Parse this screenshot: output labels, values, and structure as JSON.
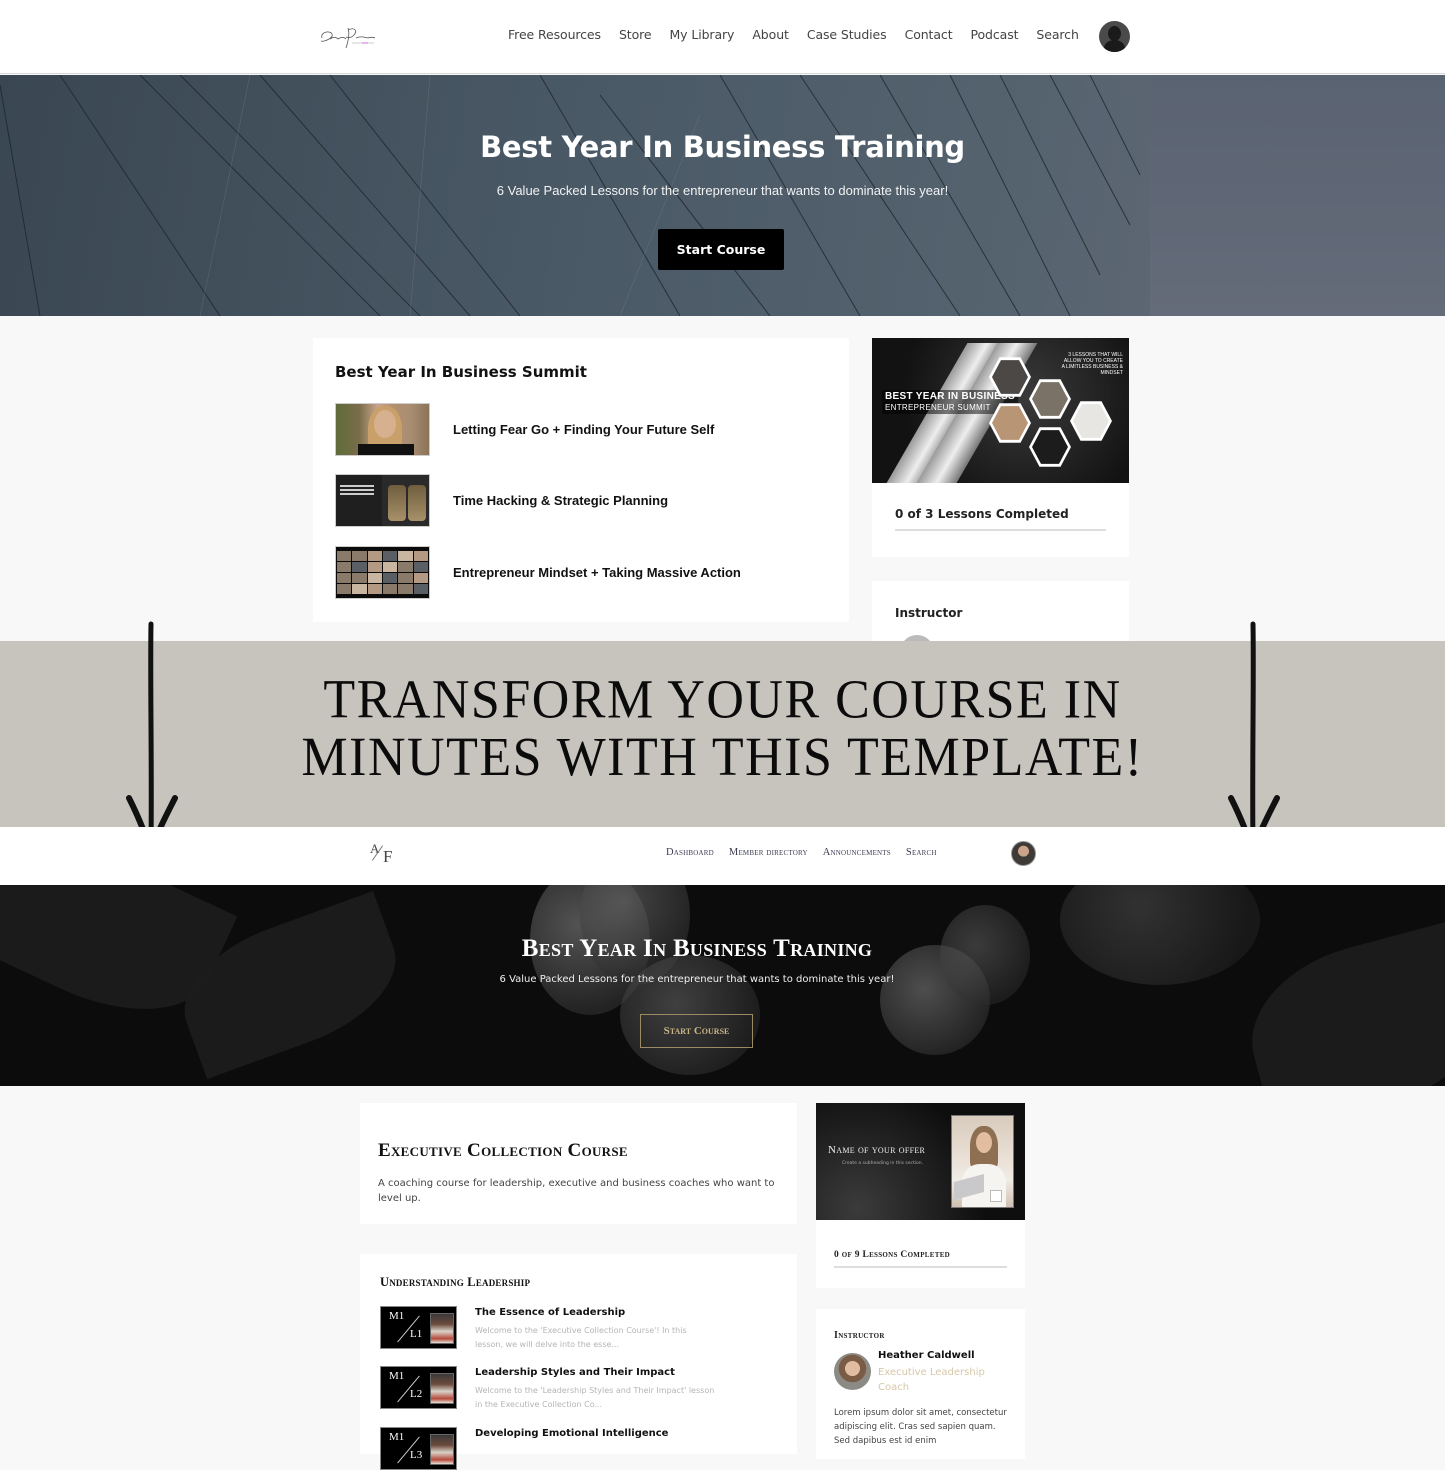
{
  "top_site": {
    "logo_alt": "signature-logo",
    "nav": [
      "Free Resources",
      "Store",
      "My Library",
      "About",
      "Case Studies",
      "Contact",
      "Podcast",
      "Search"
    ],
    "hero": {
      "title": "Best Year In Business Training",
      "subtitle": "6 Value Packed Lessons for the entrepreneur that wants to dominate this year!",
      "button": "Start Course"
    },
    "course": {
      "title": "Best Year In Business Summit",
      "lessons": [
        {
          "title": "Letting Fear Go + Finding Your Future Self"
        },
        {
          "title": "Time Hacking & Strategic Planning"
        },
        {
          "title": "Entrepreneur Mindset + Taking Massive Action"
        }
      ]
    },
    "promo": {
      "image_title_line1": "BEST YEAR IN BUSINESS",
      "image_title_line2": "ENTREPRENEUR SUMMIT",
      "image_corner": "3 LESSONS THAT WILL ALLOW YOU TO CREATE A LIMITLESS BUSINESS & MINDSET",
      "progress_label": "0 of 3 Lessons Completed",
      "completed": 0,
      "total": 3
    },
    "instructor_label": "Instructor"
  },
  "banner": {
    "line1": "TRANSFORM YOUR COURSE IN",
    "line2": "MINUTES WITH THIS TEMPLATE!"
  },
  "bottom_site": {
    "logo": {
      "a": "A",
      "f": "F"
    },
    "nav": [
      "Dashboard",
      "Member Directory",
      "Announcements",
      "Search"
    ],
    "hero": {
      "title": "Best Year In Business Training",
      "subtitle": "6 Value Packed Lessons for the entrepreneur that wants to dominate this year!",
      "button": "Start Course"
    },
    "course": {
      "title": "Executive Collection Course",
      "description": "A coaching course for leadership, executive and business coaches who want to level up."
    },
    "offer": {
      "name": "Name of your offer",
      "subheading": "Create a subheading in this section.",
      "progress_label": "0 of 9 Lessons Completed",
      "completed": 0,
      "total": 9
    },
    "module": {
      "title": "Understanding Leadership",
      "lessons": [
        {
          "m": "M1",
          "l": "L1",
          "title": "The Essence of Leadership",
          "desc": "Welcome to the 'Executive Collection Course'! In this lesson, we will delve into the esse..."
        },
        {
          "m": "M1",
          "l": "L2",
          "title": "Leadership Styles and Their Impact",
          "desc": "Welcome to the 'Leadership Styles and Their Impact' lesson in the Executive Collection Co..."
        },
        {
          "m": "M1",
          "l": "L3",
          "title": "Developing Emotional Intelligence",
          "desc": ""
        }
      ]
    },
    "instructor": {
      "label": "Instructor",
      "name": "Heather Caldwell",
      "role": "Executive Leadership Coach",
      "bio": "Lorem ipsum dolor sit amet, consectetur adipiscing elit. Cras sed sapien quam. Sed dapibus est id enim"
    }
  },
  "colors": {
    "banner_bg": "#c7c4be",
    "gold_accent": "#c8b487",
    "hero2_button_border": "#9b8a62",
    "instructor_role": "#d6c7a8"
  }
}
